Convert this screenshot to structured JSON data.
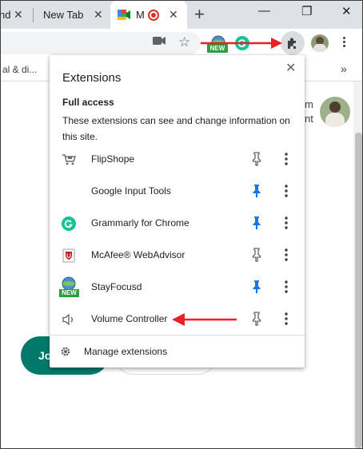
{
  "browser": {
    "tabs": [
      {
        "label": "nd"
      },
      {
        "label": "New Tab"
      },
      {
        "label": "M"
      }
    ],
    "new_tab_symbol": "+",
    "window_controls": {
      "minimize": "—",
      "restore": "❐",
      "close": "✕"
    },
    "toolbar": {
      "badge_new": "NEW",
      "icons": [
        "camera-icon",
        "star-icon",
        "stayfocusd-icon",
        "grammarly-icon",
        "extensions-puzzle-icon",
        "profile-avatar",
        "menu-dots-icon"
      ]
    },
    "bookmarks": {
      "text": "al & di...",
      "overflow": "»"
    }
  },
  "page": {
    "bg_text_line1": "m",
    "bg_text_line2": "nt",
    "join_label": "Jo",
    "accent_color": "#00796b"
  },
  "extensions_popup": {
    "title": "Extensions",
    "close_symbol": "✕",
    "section_title": "Full access",
    "section_description": "These extensions can see and change information on this site.",
    "items": [
      {
        "name": "FlipShope",
        "icon": "cart-icon",
        "pinned": false
      },
      {
        "name": "Google Input Tools",
        "icon": "",
        "pinned": true
      },
      {
        "name": "Grammarly for Chrome",
        "icon": "grammarly-icon",
        "pinned": true
      },
      {
        "name": "McAfee® WebAdvisor",
        "icon": "mcafee-icon",
        "pinned": false
      },
      {
        "name": "StayFocusd",
        "icon": "stayfocusd-icon",
        "pinned": true
      },
      {
        "name": "Volume Controller",
        "icon": "speaker-icon",
        "pinned": false
      }
    ],
    "manage_label": "Manage extensions",
    "pin_color_active": "#1a73e8",
    "pin_color_inactive": "#5f6368"
  },
  "annotations": {
    "arrow_color": "#e8202a"
  }
}
